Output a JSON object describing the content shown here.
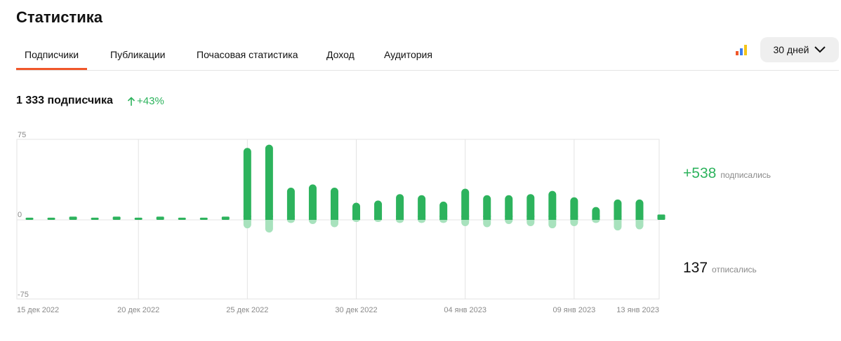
{
  "page_title": "Статистика",
  "tabs": [
    {
      "label": "Подписчики",
      "active": true
    },
    {
      "label": "Публикации",
      "active": false
    },
    {
      "label": "Почасовая статистика",
      "active": false
    },
    {
      "label": "Доход",
      "active": false
    },
    {
      "label": "Аудитория",
      "active": false
    }
  ],
  "period_selector": {
    "label": "30 дней"
  },
  "summary": {
    "subscribers": "1 333 подписчика",
    "growth": "+43%"
  },
  "side": {
    "subscribed_value": "+538",
    "subscribed_label": "подписались",
    "unsubscribed_value": "137",
    "unsubscribed_label": "отписались"
  },
  "colors": {
    "accent": "#f0572a",
    "positive": "#2db35d",
    "negative": "#a8e2bd",
    "grid": "#e3e3e3"
  },
  "icons": {
    "brand": "bar-chart-logo-icon",
    "dropdown": "chevron-down-icon",
    "growth": "arrow-up-icon"
  },
  "chart_data": {
    "type": "bar",
    "ylim": [
      -75,
      75
    ],
    "y_ticks": [
      "75",
      "0",
      "-75"
    ],
    "x_tick_labels": [
      "15 дек 2022",
      "20 дек 2022",
      "25 дек 2022",
      "30 дек 2022",
      "04 янв 2023",
      "09 янв 2023",
      "13 янв 2023"
    ],
    "categories": [
      "15 дек",
      "16 дек",
      "17 дек",
      "18 дек",
      "19 дек",
      "20 дек",
      "21 дек",
      "22 дек",
      "23 дек",
      "24 дек",
      "25 дек",
      "26 дек",
      "27 дек",
      "28 дек",
      "29 дек",
      "30 дек",
      "31 дек",
      "01 янв",
      "02 янв",
      "03 янв",
      "04 янв",
      "05 янв",
      "06 янв",
      "07 янв",
      "08 янв",
      "09 янв",
      "10 янв",
      "11 янв",
      "12 янв",
      "13 янв"
    ],
    "series": [
      {
        "name": "подписались",
        "values": [
          2,
          2,
          3,
          2,
          3,
          2,
          3,
          2,
          2,
          3,
          67,
          70,
          30,
          33,
          30,
          16,
          18,
          24,
          23,
          17,
          29,
          23,
          23,
          24,
          27,
          21,
          12,
          19,
          19,
          5
        ]
      },
      {
        "name": "отписались",
        "values": [
          0,
          0,
          0,
          0,
          0,
          0,
          0,
          0,
          0,
          0,
          -8,
          -12,
          -3,
          -4,
          -7,
          -2,
          -2,
          -3,
          -3,
          -3,
          -6,
          -7,
          -4,
          -6,
          -8,
          -6,
          -3,
          -10,
          -9,
          0
        ]
      }
    ],
    "grid": true,
    "legend": "right"
  }
}
